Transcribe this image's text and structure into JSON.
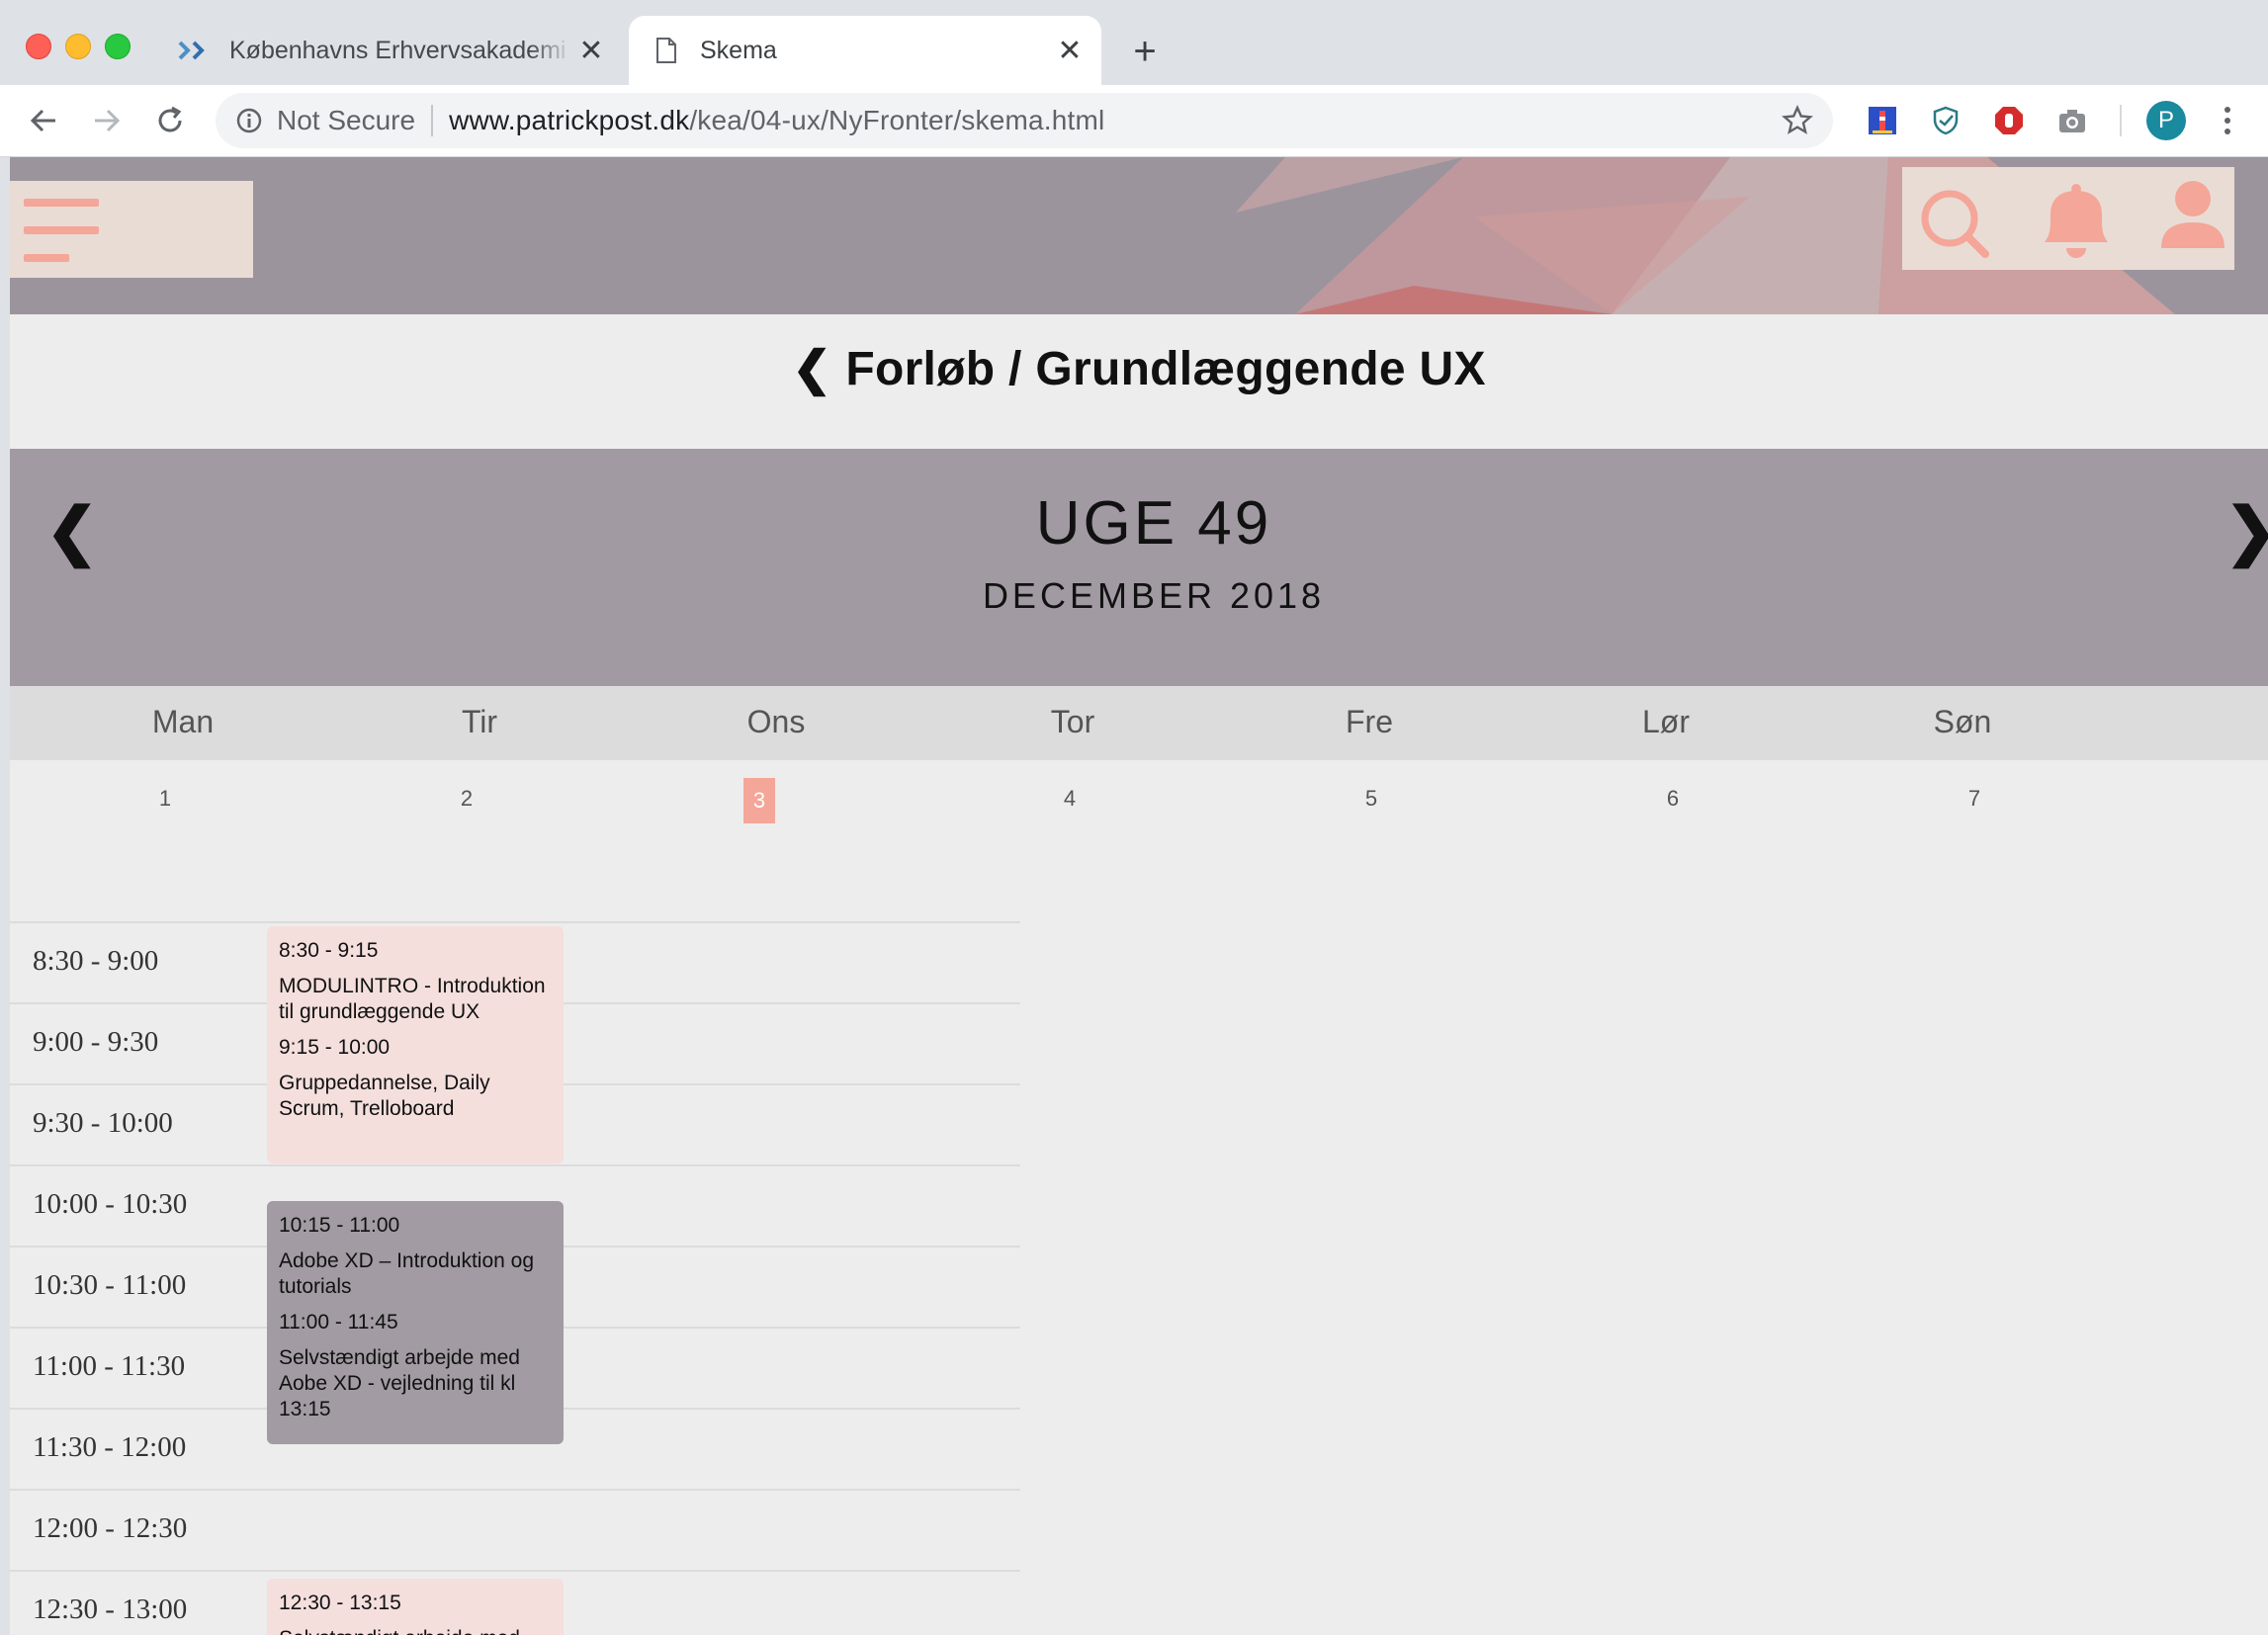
{
  "browser": {
    "tabs": [
      {
        "title": "Københavns Erhvervsakademi / KEA",
        "active": false
      },
      {
        "title": "Skema",
        "active": true
      }
    ],
    "security_label": "Not Secure",
    "url_host": "www.patrickpost.dk",
    "url_path": "/kea/04-ux/NyFronter/skema.html",
    "profile_initial": "P"
  },
  "page": {
    "breadcrumb": "❮ Forløb / Grundlæggende UX",
    "week_title": "UGE 49",
    "month": "DECEMBER 2018",
    "prev_arrow": "❮",
    "next_arrow": "❯",
    "days": [
      {
        "name": "Man",
        "num": "1"
      },
      {
        "name": "Tir",
        "num": "2"
      },
      {
        "name": "Ons",
        "num": "3"
      },
      {
        "name": "Tor",
        "num": "4"
      },
      {
        "name": "Fre",
        "num": "5"
      },
      {
        "name": "Lør",
        "num": "6"
      },
      {
        "name": "Søn",
        "num": "7"
      }
    ],
    "today_index": 2,
    "slots": [
      "8:30 - 9:00",
      "9:00 - 9:30",
      "9:30 - 10:00",
      "10:00 - 10:30",
      "10:30 - 11:00",
      "11:00 - 11:30",
      "11:30 - 12:00",
      "12:00 - 12:30",
      "12:30 - 13:00"
    ],
    "events": [
      {
        "time1": "8:30 - 9:15",
        "desc1": "MODULINTRO - Introduktion til grundlæggende UX",
        "time2": "9:15 - 10:00",
        "desc2": "Gruppedannelse, Daily Scrum, Trelloboard",
        "color": "#f4dfdd"
      },
      {
        "time1": "10:15 - 11:00",
        "desc1": "Adobe XD – Introduktion og tutorials",
        "time2": "11:00 - 11:45",
        "desc2": "Selvstændigt arbejde med Aobe XD - vejledning til kl 13:15",
        "color": "#a29ba3"
      },
      {
        "time1": "12:30 - 13:15",
        "desc1": "Selvstændigt arbejde med",
        "color": "#f4dfdd"
      }
    ]
  },
  "colors": {
    "header_bg": "#9c949d",
    "accent": "#f4a699",
    "banner_bg": "#a19aa2"
  }
}
